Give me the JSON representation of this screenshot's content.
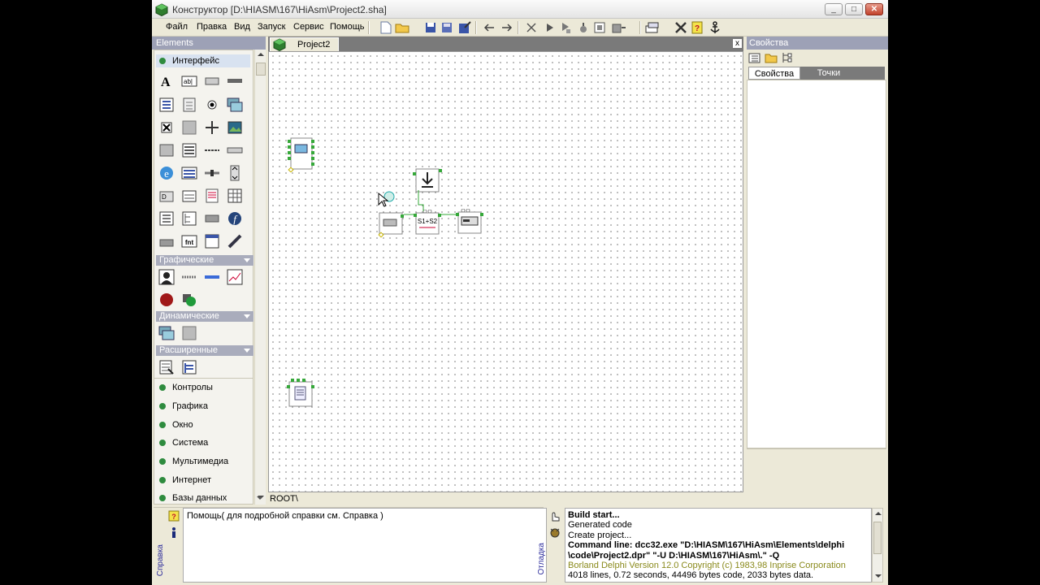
{
  "window": {
    "title": "Конструктор [D:\\HIASM\\167\\HiAsm\\Project2.sha]",
    "caption_buttons": {
      "minimize": "_",
      "maximize": "□",
      "close": "✕"
    }
  },
  "menu": [
    "Файл",
    "Правка",
    "Вид",
    "Запуск",
    "Сервис",
    "Помощь"
  ],
  "toolbar": [
    "new-file-icon",
    "open-folder-icon",
    "save-icon",
    "save-all-icon",
    "save-as-icon",
    "undo-arrow-icon",
    "redo-arrow-icon",
    "delete-icon",
    "run-icon",
    "run-debug-icon",
    "compile-icon",
    "build-icon",
    "deploy-icon",
    "window-layout-icon",
    "tools-icon",
    "help-icon",
    "anchor-icon"
  ],
  "elements": {
    "title": "Elements",
    "active_group": "Интерфейс",
    "categories": [
      "Графические",
      "Динамические",
      "Расширенные"
    ],
    "groups": [
      "Контролы",
      "Графика",
      "Окно",
      "Система",
      "Мультимедиа",
      "Интернет",
      "Базы данных"
    ]
  },
  "editor": {
    "tab": "Project2",
    "close_label": "x",
    "path": "ROOT\\",
    "component_label": "S1+S2"
  },
  "properties": {
    "title": "Свойства",
    "tabs": [
      "Свойства",
      "Точки"
    ]
  },
  "help": {
    "side_label": "Справка",
    "text": "Помощь( для подробной справки см. Справка )"
  },
  "debug": {
    "side_label": "Отладка",
    "log": [
      {
        "text": "Build start...",
        "style": "bold"
      },
      {
        "text": "Generated code",
        "style": "normal"
      },
      {
        "text": "Create project...",
        "style": "normal"
      },
      {
        "text": "Command line: dcc32.exe \"D:\\HIASM\\167\\HiAsm\\Elements\\delphi",
        "style": "bold"
      },
      {
        "text": "\\code\\Project2.dpr\" \"-U D:\\HIASM\\167\\HiAsm\\.\" -Q",
        "style": "bold"
      },
      {
        "text": "Borland Delphi  Version 12.0  Copyright (c) 1983,98 Inprise Corporation",
        "style": "olive"
      },
      {
        "text": "4018 lines, 0.72 seconds, 44496 bytes code, 2033 bytes data.",
        "style": "normal"
      }
    ]
  },
  "colors": {
    "title_bar": "#e4e4e4",
    "panel_header": "#9da1b6",
    "canvas": "#ffffff",
    "point_green": "#36a83a"
  }
}
